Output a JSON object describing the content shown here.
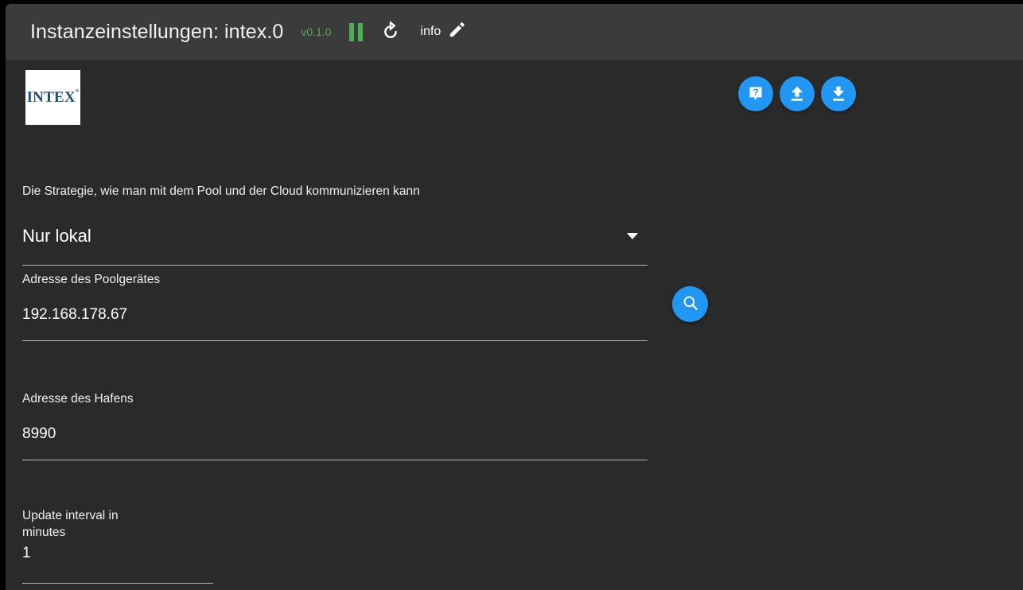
{
  "header": {
    "title": "Instanzeinstellungen: intex.0",
    "version": "v0.1.0",
    "pause_icon": "pause-icon",
    "refresh_icon": "refresh-icon",
    "info_label": "info",
    "edit_icon": "pencil-icon",
    "version_color": "#4caf50",
    "background": "#3b3b3b"
  },
  "branding": {
    "logo_text": "INTEX",
    "logo_trademark": "®"
  },
  "actions": {
    "accent_color": "#2196f3",
    "buttons": [
      {
        "name": "help-button",
        "icon": "help-icon"
      },
      {
        "name": "upload-button",
        "icon": "upload-icon"
      },
      {
        "name": "download-button",
        "icon": "download-icon"
      }
    ]
  },
  "form": {
    "strategy": {
      "label": "Die Strategie, wie man mit dem Pool und der Cloud kommunizieren kann",
      "value": "Nur lokal"
    },
    "pool_address": {
      "label": "Adresse des Poolgerätes",
      "value": "192.168.178.67",
      "search_icon": "search-icon"
    },
    "port_address": {
      "label": "Adresse des Hafens",
      "value": "8990"
    },
    "update_interval": {
      "label": "Update interval in\nminutes",
      "value": "1"
    }
  }
}
